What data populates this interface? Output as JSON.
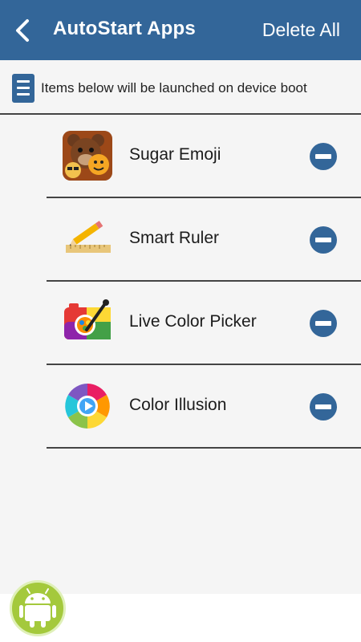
{
  "header": {
    "title": "AutoStart Apps",
    "delete_all_label": "Delete All"
  },
  "info": {
    "text": "Items below will be launched on device boot"
  },
  "apps": [
    {
      "name": "Sugar Emoji",
      "icon": "sugar-emoji-icon"
    },
    {
      "name": "Smart Ruler",
      "icon": "smart-ruler-icon"
    },
    {
      "name": "Live Color Picker",
      "icon": "live-color-picker-icon"
    },
    {
      "name": "Color Illusion",
      "icon": "color-illusion-icon"
    }
  ],
  "colors": {
    "primary": "#336699",
    "android_green": "#a4c93c"
  }
}
